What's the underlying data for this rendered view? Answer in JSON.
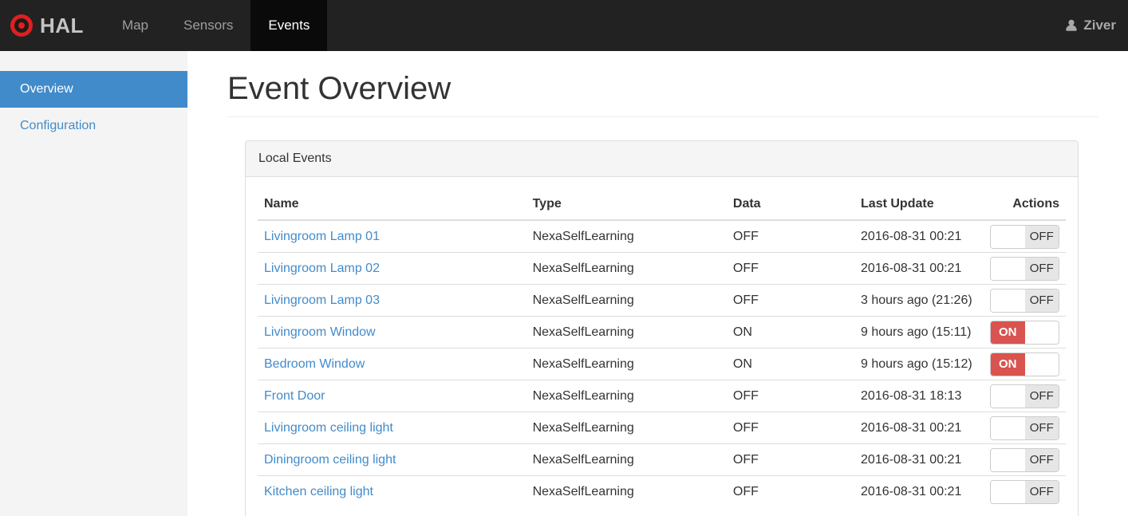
{
  "navbar": {
    "brand": "HAL",
    "items": [
      {
        "label": "Map",
        "active": false
      },
      {
        "label": "Sensors",
        "active": false
      },
      {
        "label": "Events",
        "active": true
      }
    ],
    "user": "Ziver"
  },
  "sidebar": {
    "items": [
      {
        "label": "Overview",
        "active": true
      },
      {
        "label": "Configuration",
        "active": false
      }
    ]
  },
  "main": {
    "title": "Event Overview",
    "panel": {
      "title": "Local Events",
      "table": {
        "columns": [
          "Name",
          "Type",
          "Data",
          "Last Update",
          "Actions"
        ],
        "switch_labels": {
          "on": "ON",
          "off": "OFF"
        },
        "rows": [
          {
            "name": "Livingroom Lamp 01",
            "type": "NexaSelfLearning",
            "data": "OFF",
            "last_update": "2016-08-31 00:21",
            "switch": "OFF"
          },
          {
            "name": "Livingroom Lamp 02",
            "type": "NexaSelfLearning",
            "data": "OFF",
            "last_update": "2016-08-31 00:21",
            "switch": "OFF"
          },
          {
            "name": "Livingroom Lamp 03",
            "type": "NexaSelfLearning",
            "data": "OFF",
            "last_update": "3 hours ago (21:26)",
            "switch": "OFF"
          },
          {
            "name": "Livingroom Window",
            "type": "NexaSelfLearning",
            "data": "ON",
            "last_update": "9 hours ago (15:11)",
            "switch": "ON"
          },
          {
            "name": "Bedroom Window",
            "type": "NexaSelfLearning",
            "data": "ON",
            "last_update": "9 hours ago (15:12)",
            "switch": "ON"
          },
          {
            "name": "Front Door",
            "type": "NexaSelfLearning",
            "data": "OFF",
            "last_update": "2016-08-31 18:13",
            "switch": "OFF"
          },
          {
            "name": "Livingroom ceiling light",
            "type": "NexaSelfLearning",
            "data": "OFF",
            "last_update": "2016-08-31 00:21",
            "switch": "OFF"
          },
          {
            "name": "Diningroom ceiling light",
            "type": "NexaSelfLearning",
            "data": "OFF",
            "last_update": "2016-08-31 00:21",
            "switch": "OFF"
          },
          {
            "name": "Kitchen ceiling light",
            "type": "NexaSelfLearning",
            "data": "OFF",
            "last_update": "2016-08-31 00:21",
            "switch": "OFF"
          }
        ]
      }
    }
  },
  "colors": {
    "accent_blue": "#428bca",
    "switch_on_red": "#d9534f",
    "navbar_bg": "#222222",
    "logo_red": "#e01f1f"
  }
}
